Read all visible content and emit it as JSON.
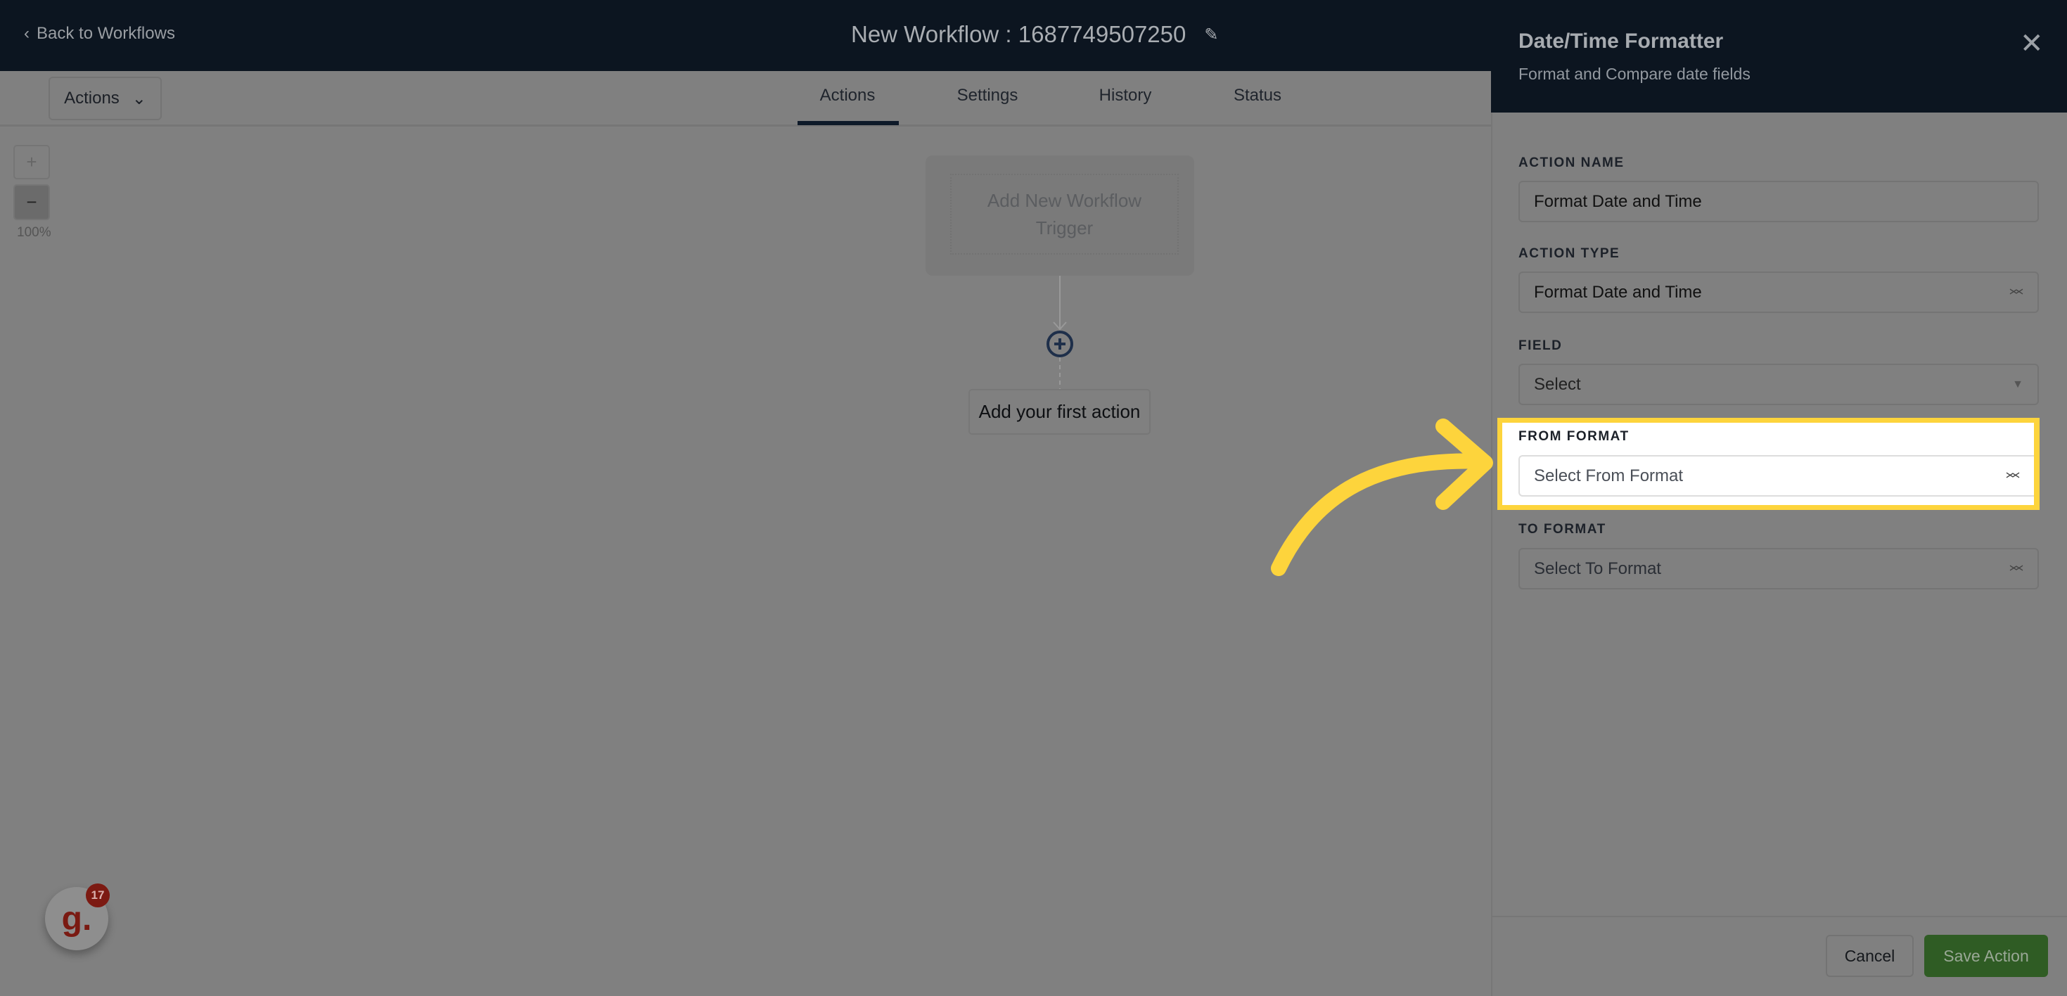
{
  "header": {
    "back_label": "Back to Workflows",
    "title": "New Workflow : 1687749507250"
  },
  "toolbar": {
    "actions_dropdown": "Actions",
    "tabs": [
      {
        "label": "Actions",
        "active": true
      },
      {
        "label": "Settings"
      },
      {
        "label": "History"
      },
      {
        "label": "Status"
      }
    ]
  },
  "canvas": {
    "zoom_in": "+",
    "zoom_out": "−",
    "zoom_level": "100%",
    "trigger_label": "Add New Workflow Trigger",
    "first_action_label": "Add your first action"
  },
  "panel": {
    "title": "Date/Time Formatter",
    "subtitle": "Format and Compare date fields",
    "fields": {
      "action_name": {
        "label": "ACTION NAME",
        "value": "Format Date and Time"
      },
      "action_type": {
        "label": "ACTION TYPE",
        "value": "Format Date and Time"
      },
      "field": {
        "label": "FIELD",
        "placeholder": "Select"
      },
      "from_format": {
        "label": "FROM FORMAT",
        "placeholder": "Select From Format"
      },
      "to_format": {
        "label": "TO FORMAT",
        "placeholder": "Select To Format"
      }
    },
    "cancel_label": "Cancel",
    "save_label": "Save Action"
  },
  "widget": {
    "avatar_letter": "g.",
    "badge_count": "17"
  },
  "colors": {
    "highlight": "#fdd43c",
    "save_green": "#2f5c24",
    "header_bg": "#0c1520"
  }
}
